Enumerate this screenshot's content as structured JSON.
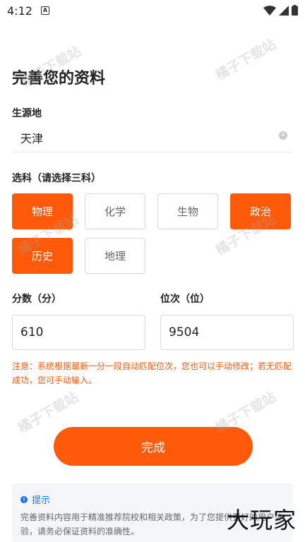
{
  "status_bar": {
    "time": "4:12",
    "notif": "A"
  },
  "page": {
    "title": "完善您的资料"
  },
  "origin": {
    "label": "生源地",
    "value": "天津"
  },
  "subjects": {
    "label": "选科（请选择三科）",
    "items": [
      {
        "label": "物理",
        "selected": true
      },
      {
        "label": "化学",
        "selected": false
      },
      {
        "label": "生物",
        "selected": false
      },
      {
        "label": "政治",
        "selected": true
      },
      {
        "label": "历史",
        "selected": true
      },
      {
        "label": "地理",
        "selected": false
      }
    ]
  },
  "score": {
    "label": "分数（分）",
    "value": "610"
  },
  "rank": {
    "label": "位次（位）",
    "value": "9504"
  },
  "notice": "注意：系统根据最新一分一段自动匹配位次，您也可以手动修改；若无匹配成功，您可手动输入。",
  "done_label": "完成",
  "tip": {
    "title": "提示",
    "text": "完善资料内容用于精准推荐院校和相关政策，为了您提供更好的用户体验，请务必保证资料的准确性。"
  },
  "watermark": "橘子下载站",
  "logo": "大玩家",
  "colors": {
    "accent": "#ff5a0a",
    "info": "#1a73e8"
  }
}
